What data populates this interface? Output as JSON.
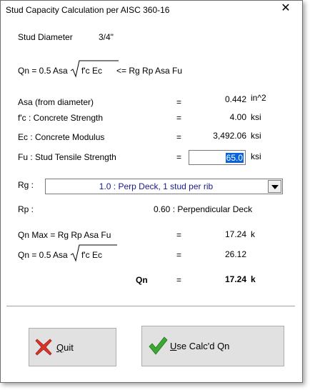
{
  "window": {
    "title": "Stud Capacity Calculation per AISC 360-16",
    "close_glyph": "✕"
  },
  "stud_diameter": {
    "label": "Stud Diameter",
    "value": "3/4\""
  },
  "formula_top": {
    "lhs": "Qn = 0.5  Asa",
    "radicand": "f'c  Ec",
    "rhs": "<=   Rg  Rp  Asa  Fu"
  },
  "rows": {
    "asa": {
      "label": "Asa (from diameter)",
      "eq": "=",
      "value": "0.442",
      "unit": "in^2"
    },
    "fc": {
      "label": "f'c : Concrete Strength",
      "eq": "=",
      "value": "4.00",
      "unit": "ksi"
    },
    "ec": {
      "label": "Ec : Concrete Modulus",
      "eq": "=",
      "value": "3,492.06",
      "unit": "ksi"
    },
    "fu": {
      "label": "Fu : Stud Tensile Strength",
      "eq": "=",
      "value": "65.0",
      "unit": "ksi"
    }
  },
  "rg": {
    "label": "Rg :",
    "selected": "1.0  : Perp Deck, 1 stud per rib"
  },
  "rp": {
    "label": "Rp :",
    "value": "0.60 : Perpendicular Deck"
  },
  "qn_max": {
    "label": "Qn Max =  Rg  Rp  Asa  Fu",
    "eq": "=",
    "value": "17.24",
    "unit": "k"
  },
  "qn_formula": {
    "lhs": "Qn = 0.5  Asa",
    "radicand": "f'c  Ec",
    "eq": "=",
    "value": "26.12"
  },
  "qn_result": {
    "label": "Qn",
    "eq": "=",
    "value": "17.24",
    "unit": "k"
  },
  "buttons": {
    "quit": "Quit",
    "quit_key": "Q",
    "quit_rest": "uit",
    "use": "Use Calc'd Qn",
    "use_key": "U",
    "use_rest": "se Calc'd Qn"
  },
  "colors": {
    "accent": "#0a64d8",
    "combo_text": "#1a1a8c",
    "quit_icon": "#d9342b",
    "check_icon": "#3aa832"
  }
}
